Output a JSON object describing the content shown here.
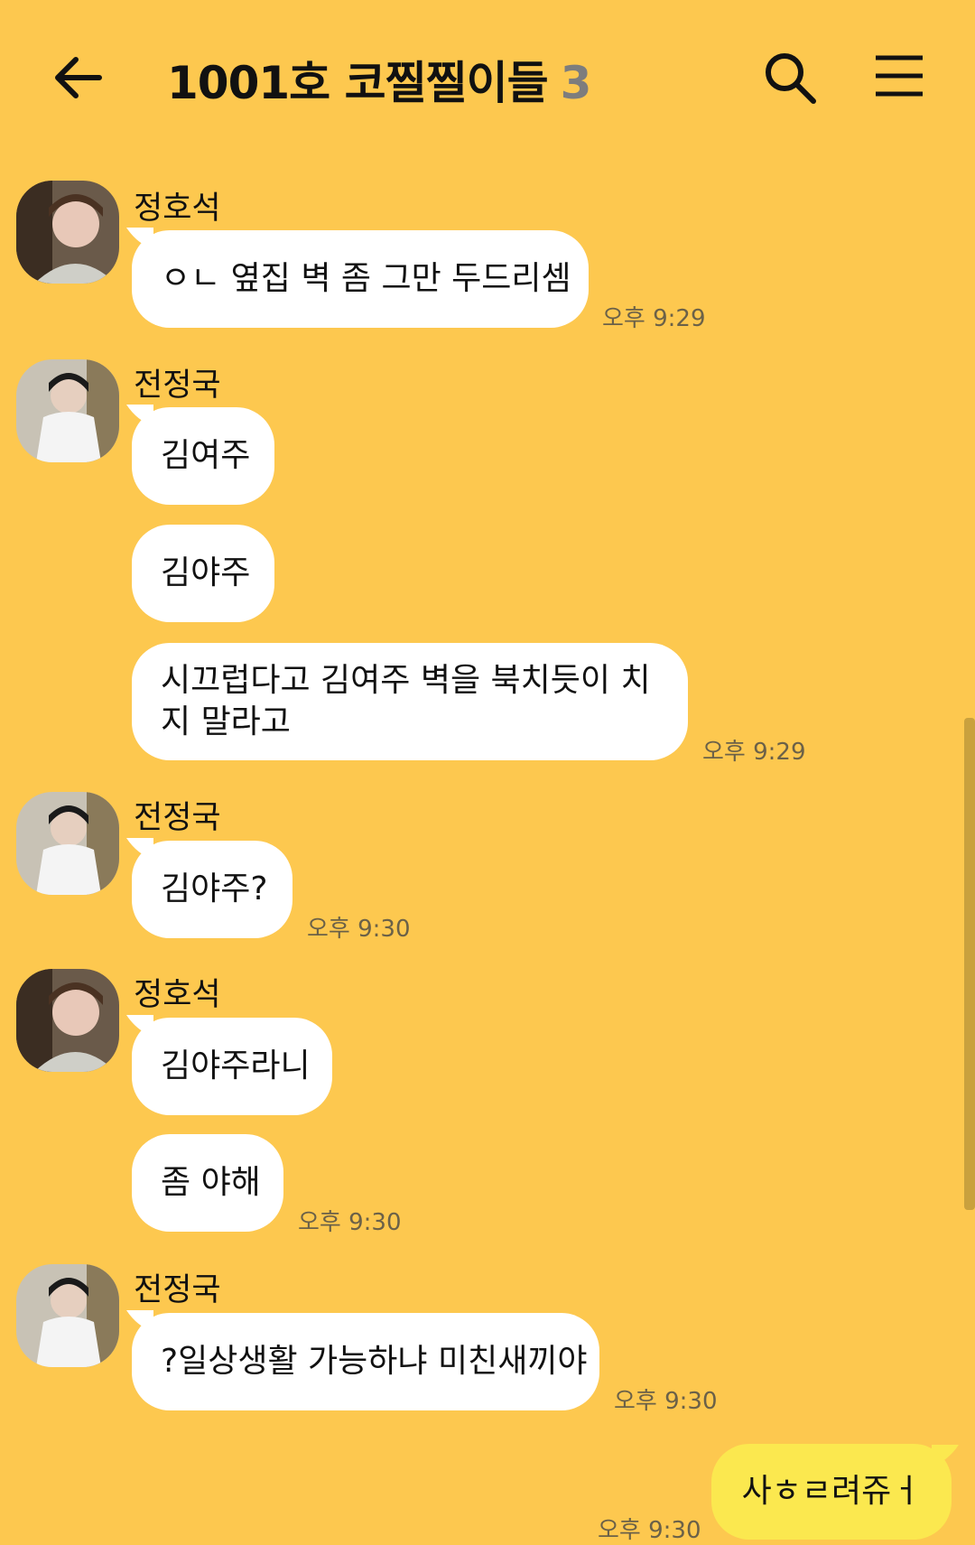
{
  "header": {
    "title": "1001호 코찔찔이들",
    "member_count": "3",
    "back_icon": "arrow-left-icon",
    "search_icon": "search-icon",
    "menu_icon": "menu-icon"
  },
  "messages": [
    {
      "sender": "정호석",
      "texts": [
        "ㅇㄴ 옆집 벽 좀 그만 두드리셈"
      ],
      "time": "오후 9:29"
    },
    {
      "sender": "전정국",
      "texts": [
        "김여주",
        "김야주",
        "시끄럽다고 김여주 벽을 북치듯이 치지 말라고"
      ],
      "time": "오후 9:29"
    },
    {
      "sender": "전정국",
      "texts": [
        "김야주?"
      ],
      "time": "오후 9:30"
    },
    {
      "sender": "정호석",
      "texts": [
        "김야주라니",
        "좀 야해"
      ],
      "time": "오후 9:30"
    },
    {
      "sender": "전정국",
      "texts": [
        "?일상생활 가능하냐 미친새끼야"
      ],
      "time": "오후 9:30"
    }
  ],
  "my_message": {
    "text": "사ㅎㄹ려쥬ㅓ",
    "time": "오후 9:30"
  },
  "colors": {
    "background": "#FDC84F",
    "bubble": "#FFFFFF",
    "my_bubble": "#FBE84F"
  }
}
